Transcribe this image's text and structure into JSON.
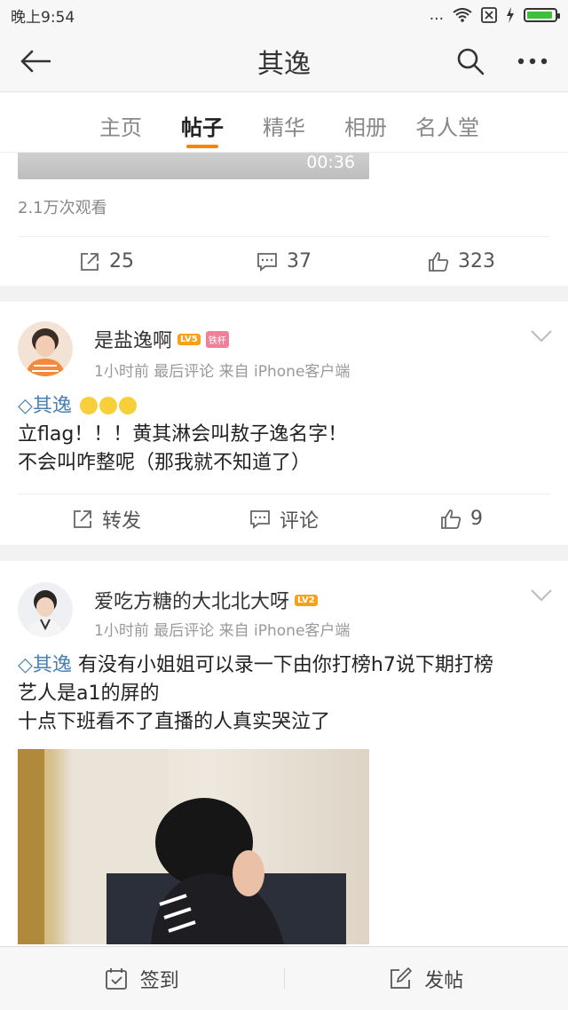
{
  "status_bar": {
    "time": "晚上9:54",
    "signal": "...",
    "wifi": "wifi-icon"
  },
  "nav": {
    "title": "其逸"
  },
  "tabs": [
    "主页",
    "帖子",
    "精华",
    "相册",
    "名人堂"
  ],
  "top_post": {
    "video_duration": "00:36",
    "views": "2.1万次观看",
    "repost_count": "25",
    "comment_count": "37",
    "like_count": "323"
  },
  "posts": [
    {
      "username": "是盐逸啊",
      "level": "LV5",
      "badge": "铁杆",
      "meta": "1小时前 最后评论    来自 iPhone客户端",
      "topic": "其逸",
      "line1": "立flag！！！黄其淋会叫敖子逸名字！",
      "line2": "不会叫咋整呢（那我就不知道了）",
      "repost_label": "转发",
      "comment_label": "评论",
      "like_count": "9"
    },
    {
      "username": "爱吃方糖的大北北大呀",
      "level": "LV2",
      "meta": "1小时前 最后评论    来自 iPhone客户端",
      "topic": "其逸",
      "text1": " 有没有小姐姐可以录一下由你打榜h7说下期打榜",
      "line2": "艺人是a1的屏的",
      "line3": "十点下班看不了直播的人真实哭泣了"
    }
  ],
  "bottom": {
    "checkin": "签到",
    "post": "发帖"
  }
}
